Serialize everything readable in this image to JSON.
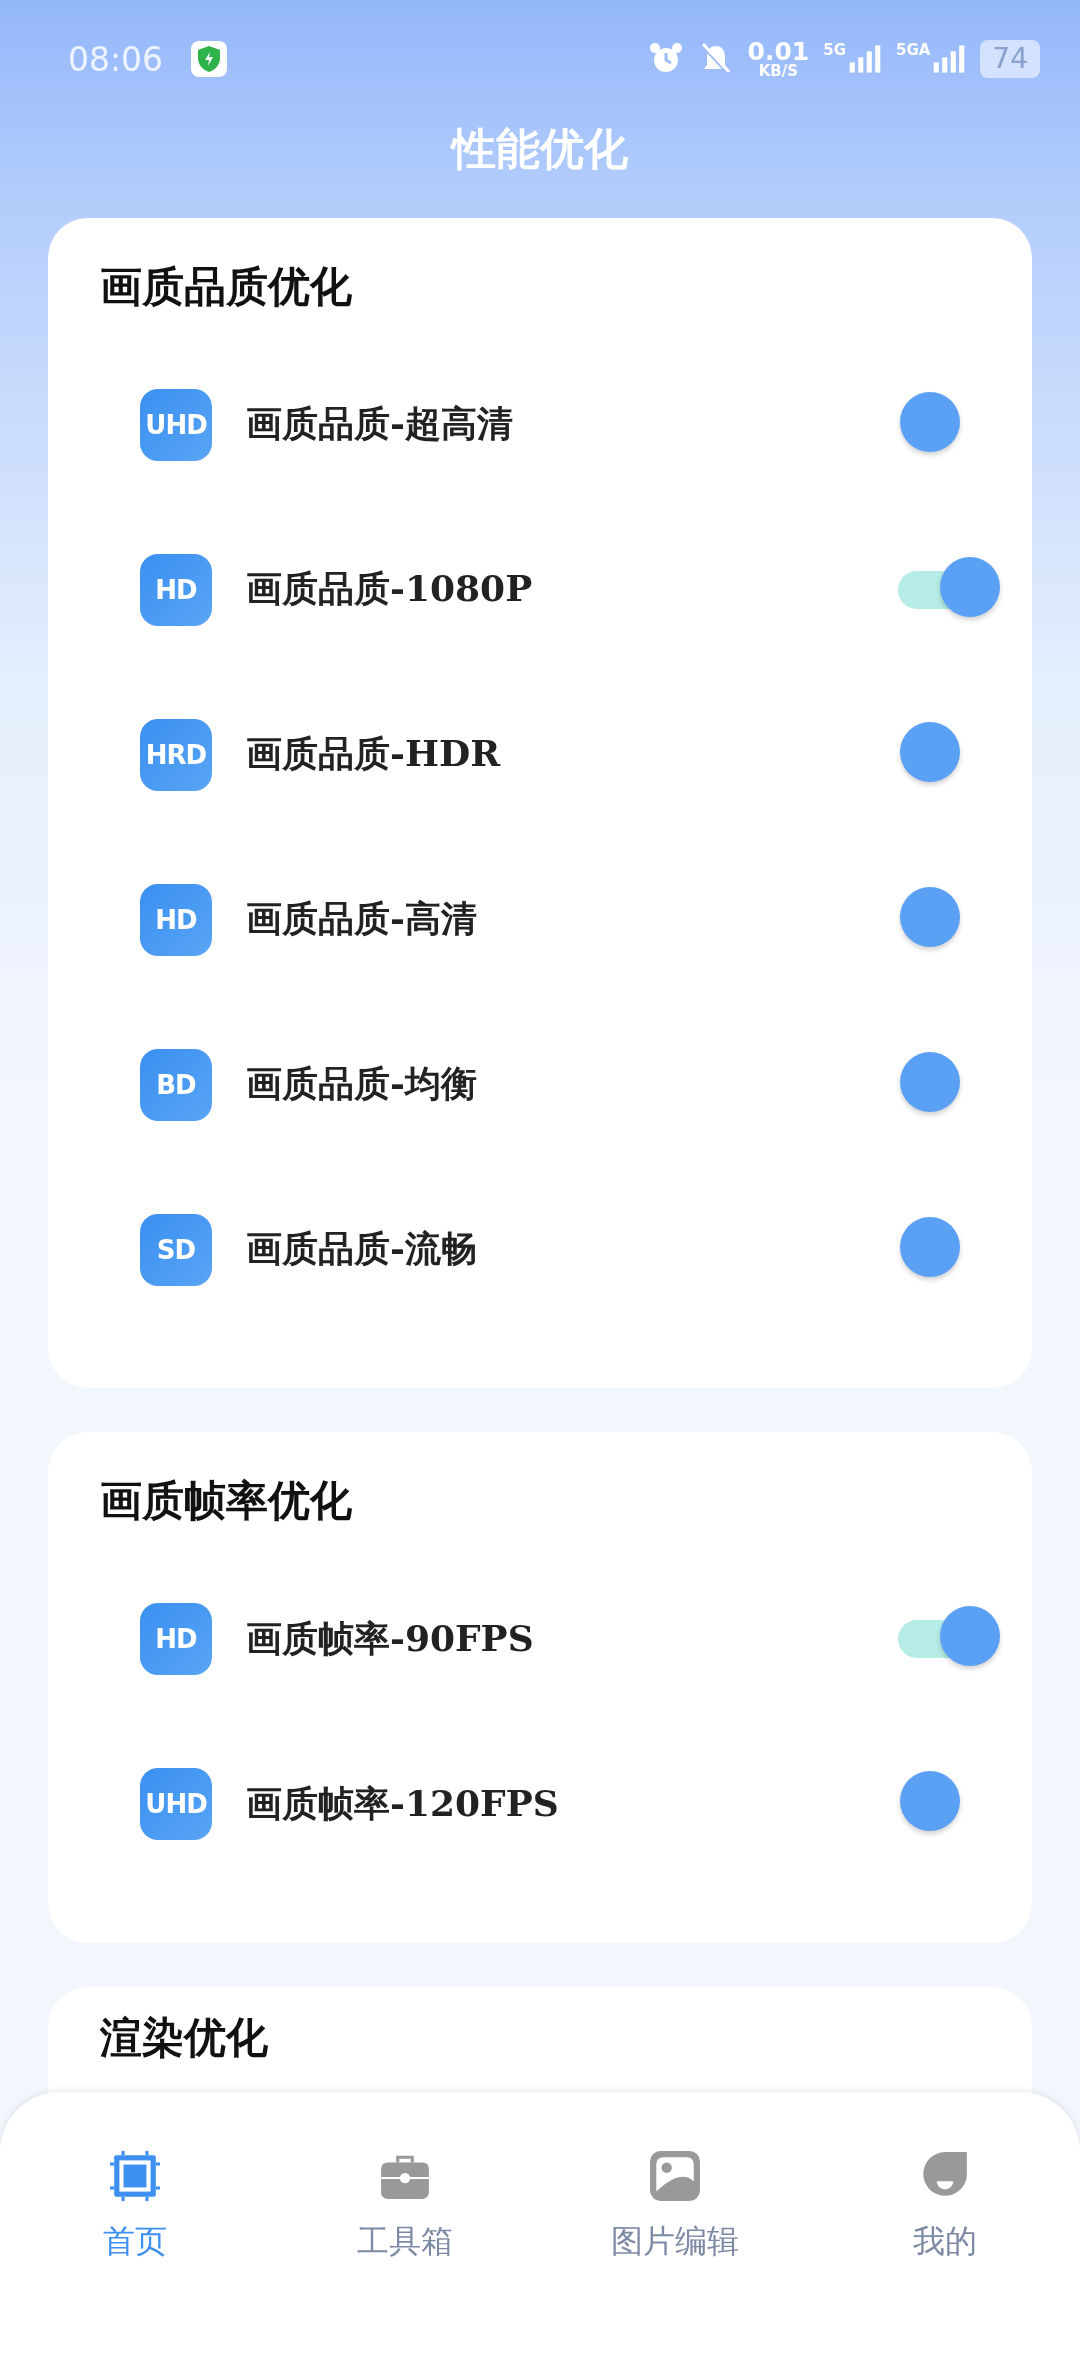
{
  "status_bar": {
    "time": "08:06",
    "net_speed": "0.01",
    "net_unit": "KB/S",
    "net1": "5G",
    "net2": "5GA",
    "battery": "74"
  },
  "title": "性能优化",
  "sections": [
    {
      "title": "画质品质优化",
      "items": [
        {
          "badge": "UHD",
          "label": "画质品质-超高清",
          "on": false
        },
        {
          "badge": "HD",
          "label": "画质品质-1080P",
          "on": true
        },
        {
          "badge": "HRD",
          "label": "画质品质-HDR",
          "on": false
        },
        {
          "badge": "HD",
          "label": "画质品质-高清",
          "on": false
        },
        {
          "badge": "BD",
          "label": "画质品质-均衡",
          "on": false
        },
        {
          "badge": "SD",
          "label": "画质品质-流畅",
          "on": false
        }
      ]
    },
    {
      "title": "画质帧率优化",
      "items": [
        {
          "badge": "HD",
          "label": "画质帧率-90FPS",
          "on": true
        },
        {
          "badge": "UHD",
          "label": "画质帧率-120FPS",
          "on": false
        }
      ]
    },
    {
      "title": "渲染优化"
    }
  ],
  "nav": [
    {
      "kind": "chip",
      "label": "首页",
      "selected": true
    },
    {
      "kind": "toolbox",
      "label": "工具箱",
      "selected": false
    },
    {
      "kind": "image",
      "label": "图片编辑",
      "selected": false
    },
    {
      "kind": "face",
      "label": "我的",
      "selected": false
    }
  ]
}
